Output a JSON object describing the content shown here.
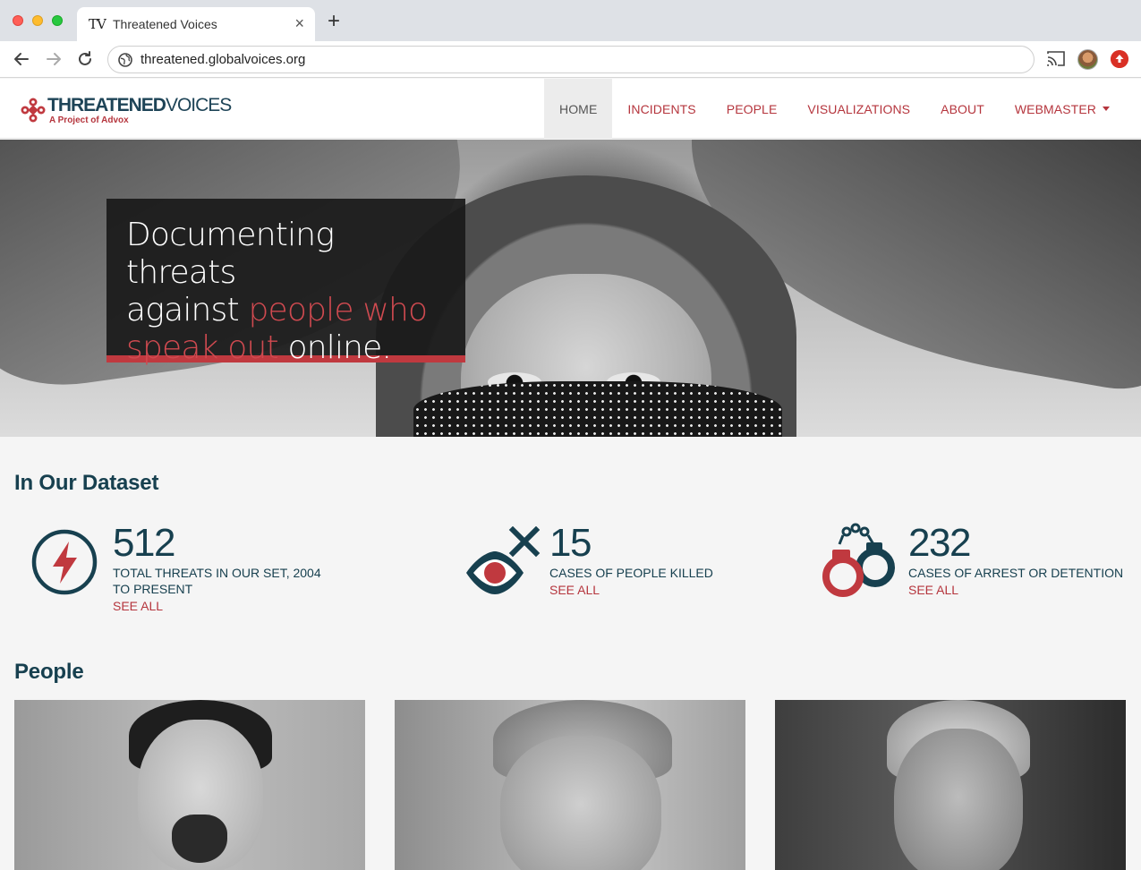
{
  "browser": {
    "tab_title": "Threatened Voices",
    "tab_favicon": "TV",
    "url": "threatened.globalvoices.org"
  },
  "site": {
    "logo_strong": "THREATENED",
    "logo_light": "VOICES",
    "logo_sub": "A Project of Advox",
    "nav": [
      {
        "label": "HOME",
        "active": true
      },
      {
        "label": "INCIDENTS"
      },
      {
        "label": "PEOPLE"
      },
      {
        "label": "VISUALIZATIONS"
      },
      {
        "label": "ABOUT"
      },
      {
        "label": "WEBMASTER",
        "dropdown": true
      }
    ]
  },
  "hero": {
    "line1": "Documenting threats",
    "line2_plain": "against ",
    "line2_accent": "people who",
    "line3_accent": "speak out",
    "line3_plain": " online."
  },
  "dataset": {
    "title": "In Our Dataset",
    "stats": [
      {
        "icon": "lightning-icon",
        "value": "512",
        "label": "TOTAL THREATS IN OUR SET, 2004 TO PRESENT",
        "link": "SEE ALL"
      },
      {
        "icon": "crossed-eye-icon",
        "value": "15",
        "label": "CASES OF PEOPLE KILLED",
        "link": "SEE ALL"
      },
      {
        "icon": "handcuffs-icon",
        "value": "232",
        "label": "CASES OF ARREST OR DETENTION",
        "link": "SEE ALL"
      }
    ]
  },
  "people": {
    "title": "People"
  },
  "colors": {
    "brand_red": "#b5353d",
    "brand_navy": "#17404f",
    "hero_accent": "#d04a50"
  }
}
